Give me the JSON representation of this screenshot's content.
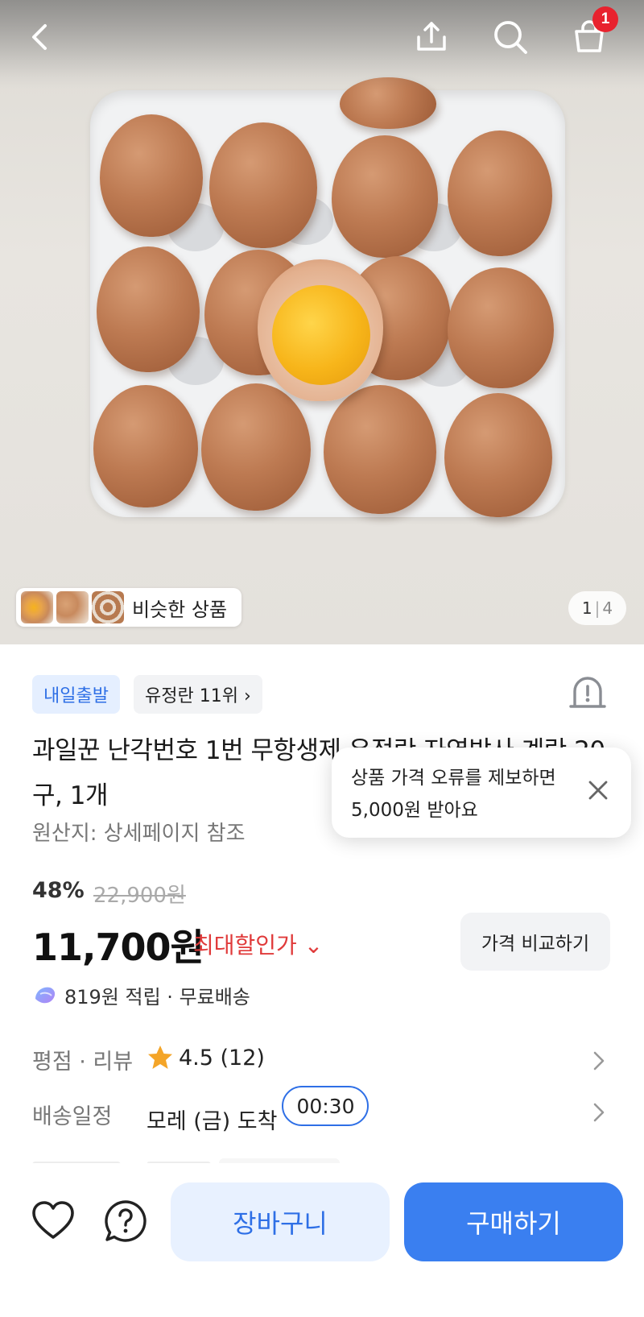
{
  "header": {
    "cart_count": "1"
  },
  "gallery": {
    "similar_label": "비슷한 상품",
    "page_current": "1",
    "page_separator": "|",
    "page_total": "4"
  },
  "tags": {
    "shipping": "내일출발",
    "rank": "유정란 11위 ›"
  },
  "product": {
    "title": "과일꾼 난각번호 1번 무항생제 유정란 자연방사 계란 20구, 1개",
    "origin": "원산지: 상세페이지 참조"
  },
  "tooltip": {
    "text": "상품 가격 오류를 제보하면\n5,000원 받아요"
  },
  "price": {
    "discount": "48%",
    "original": "22,900원",
    "sale": "11,700원",
    "max_discount_label": "최대할인가 ⌄",
    "compare_label": "가격 비교하기",
    "points_text": "819원 적립 · 무료배송"
  },
  "rows": {
    "rating_label": "평점 · 리뷰",
    "rating_value": "4.5 (12)",
    "delivery_label": "배송일정",
    "delivery_value": "모레 (금) 도착",
    "timer": "00:30"
  },
  "actions": {
    "cart": "장바구니",
    "buy": "구매하기"
  },
  "colors": {
    "accent_blue": "#3a7ff0",
    "sale_red": "#e03a3a",
    "badge_red": "#e8222e",
    "star": "#f4a528"
  }
}
